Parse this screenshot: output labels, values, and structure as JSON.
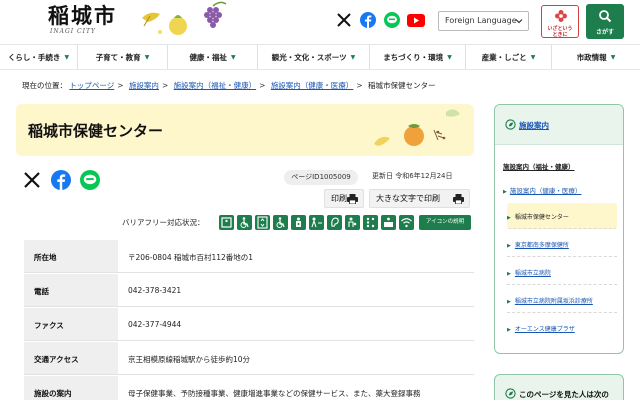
{
  "header": {
    "logo_text": "稲城市",
    "logo_sub": "INAGI CITY",
    "language_label": "Foreign Language",
    "emergency_label_line1": "いざという",
    "emergency_label_line2": "ときに",
    "search_label": "さがす"
  },
  "nav": [
    {
      "label": "くらし・手続き"
    },
    {
      "label": "子育て・教育"
    },
    {
      "label": "健康・福祉"
    },
    {
      "label": "観光・文化・スポーツ"
    },
    {
      "label": "まちづくり・環境"
    },
    {
      "label": "産業・しごと"
    },
    {
      "label": "市政情報"
    }
  ],
  "breadcrumb": {
    "prefix": "現在の位置：",
    "items": [
      "トップページ",
      "施設案内",
      "施設案内（福祉・健康）",
      "施設案内（健康・医療）"
    ],
    "current": "稲城市保健センター"
  },
  "page": {
    "title": "稲城市保健センター",
    "page_id": "ページID1005009",
    "updated": "更新日  令和6年12月24日",
    "print_label": "印刷",
    "print_large_label": "大きな文字で印刷",
    "barrier_free_label": "バリアフリー対応状況：",
    "icon_legend_label": "アイコンの説明"
  },
  "facility_table": [
    {
      "header": "所在地",
      "value": "〒206-0804 稲城市百村112番地の1"
    },
    {
      "header": "電話",
      "value": "042-378-3421"
    },
    {
      "header": "ファクス",
      "value": "042-377-4944"
    },
    {
      "header": "交通アクセス",
      "value": "京王相模原線稲城駅から徒歩約10分"
    },
    {
      "header": "施設の案内",
      "value": "母子保健事業、予防接種事業、健康増進事業などの保健サービス、また、薬大登録事務"
    }
  ],
  "sidebar": {
    "heading": "施設案内",
    "category": "施設案内（福祉・健康）",
    "subcategory": "施設案内（健康・医療）",
    "items": [
      "稲城市保健センター",
      "東京都南多摩保健所",
      "稲城市立病院",
      "稲城市立病院附属坂浜診療所",
      "オーエンス健康プラザ"
    ],
    "second_heading": "このページを見た人は次の"
  },
  "colors": {
    "accent_green": "#1e7d4c",
    "title_bg": "#fff7cc",
    "link_blue": "#1a56b4"
  }
}
